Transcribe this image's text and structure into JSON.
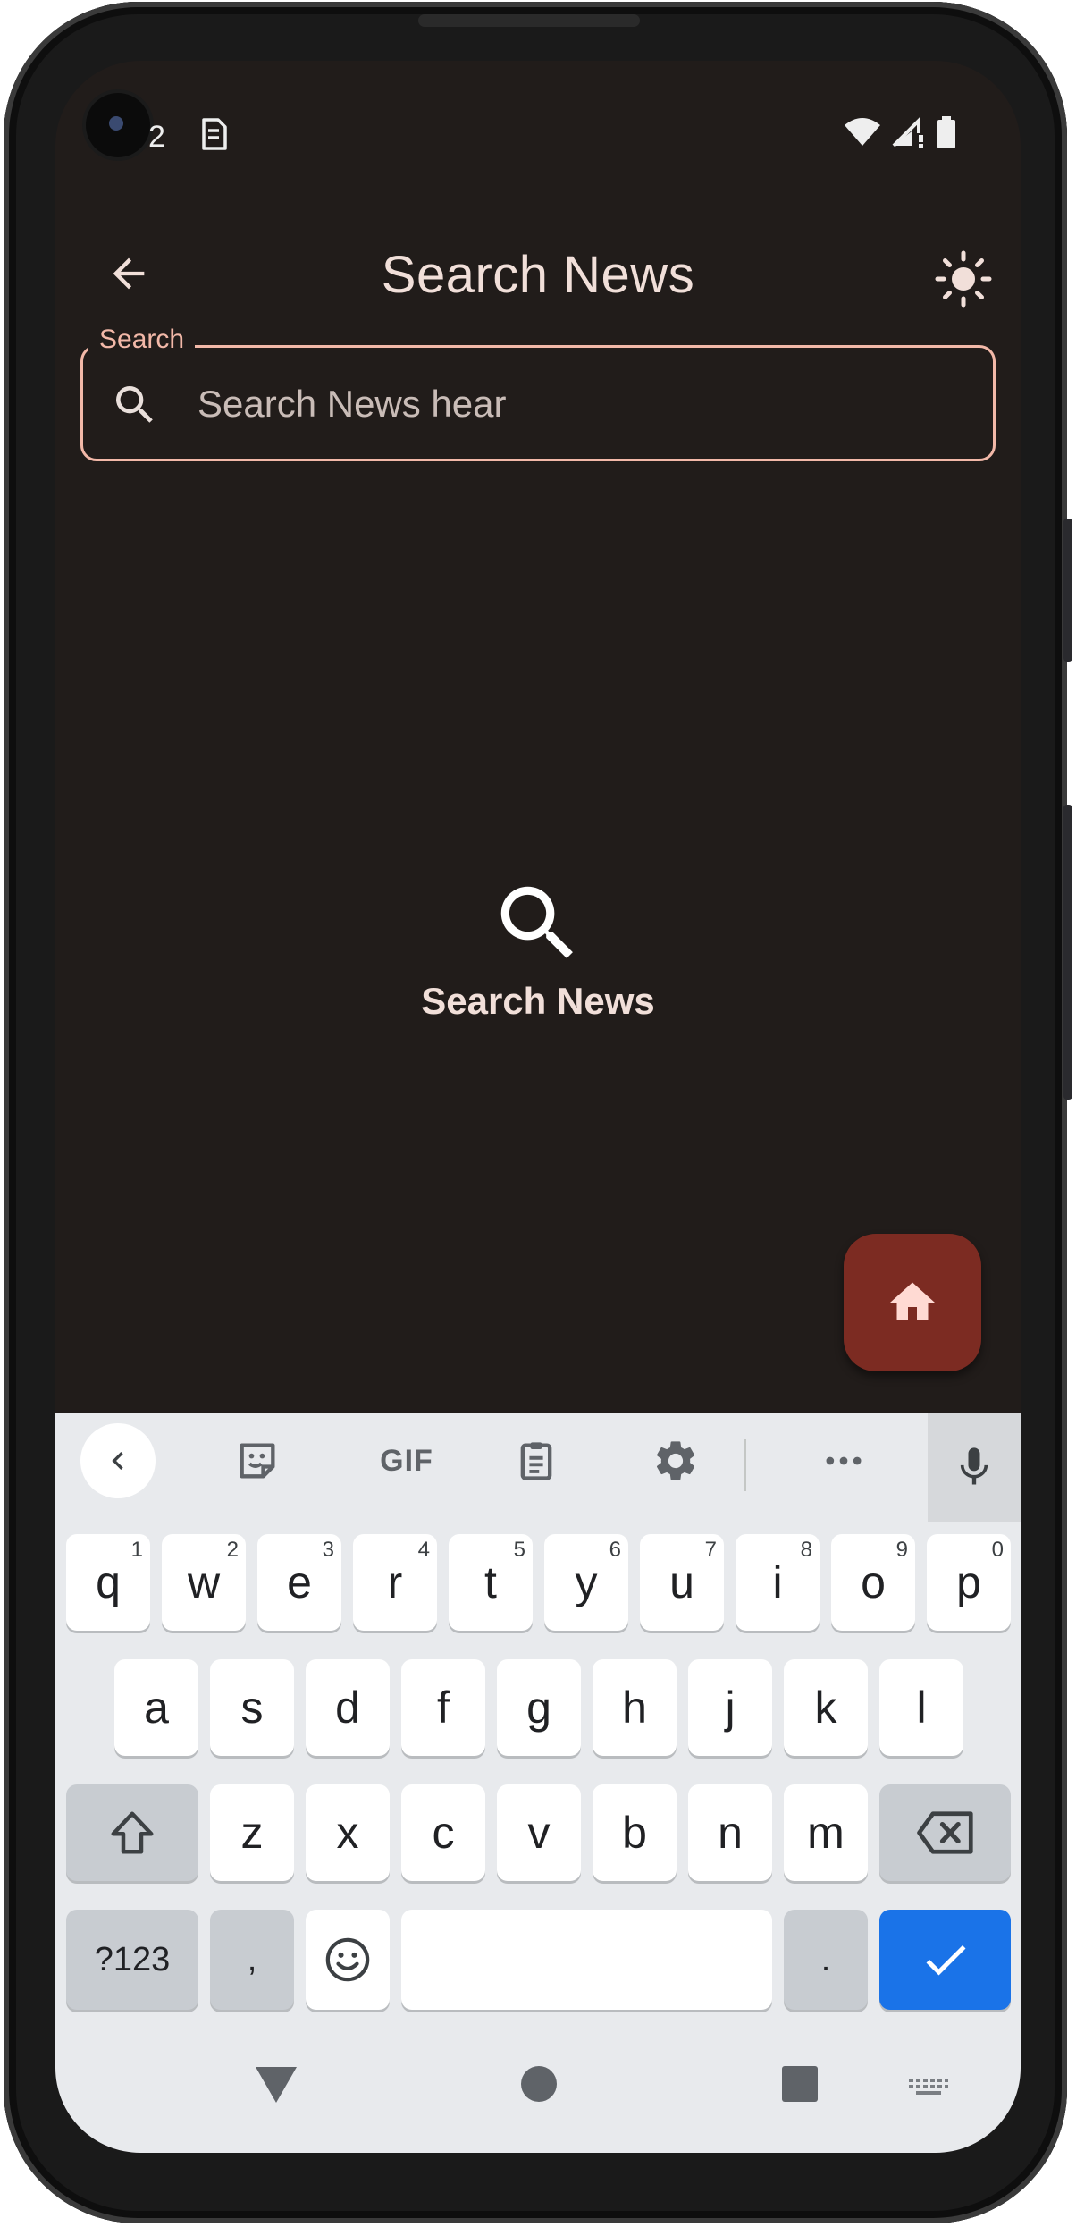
{
  "status_bar": {
    "notification_count": "2"
  },
  "app_bar": {
    "title": "Search News"
  },
  "search": {
    "label": "Search",
    "placeholder": "Search News hear",
    "value": ""
  },
  "empty_state": {
    "text": "Search News"
  },
  "keyboard": {
    "toolbar": {
      "gif_label": "GIF"
    },
    "row1": [
      {
        "key": "q",
        "hint": "1"
      },
      {
        "key": "w",
        "hint": "2"
      },
      {
        "key": "e",
        "hint": "3"
      },
      {
        "key": "r",
        "hint": "4"
      },
      {
        "key": "t",
        "hint": "5"
      },
      {
        "key": "y",
        "hint": "6"
      },
      {
        "key": "u",
        "hint": "7"
      },
      {
        "key": "i",
        "hint": "8"
      },
      {
        "key": "o",
        "hint": "9"
      },
      {
        "key": "p",
        "hint": "0"
      }
    ],
    "row2": [
      "a",
      "s",
      "d",
      "f",
      "g",
      "h",
      "j",
      "k",
      "l"
    ],
    "row3": [
      "z",
      "x",
      "c",
      "v",
      "b",
      "n",
      "m"
    ],
    "symbols_label": "?123",
    "comma_label": ",",
    "period_label": "."
  },
  "colors": {
    "background": "#211c1a",
    "accent": "#f2b8a8",
    "fab": "#7c2b22",
    "keyboard_action": "#1a73e8"
  }
}
